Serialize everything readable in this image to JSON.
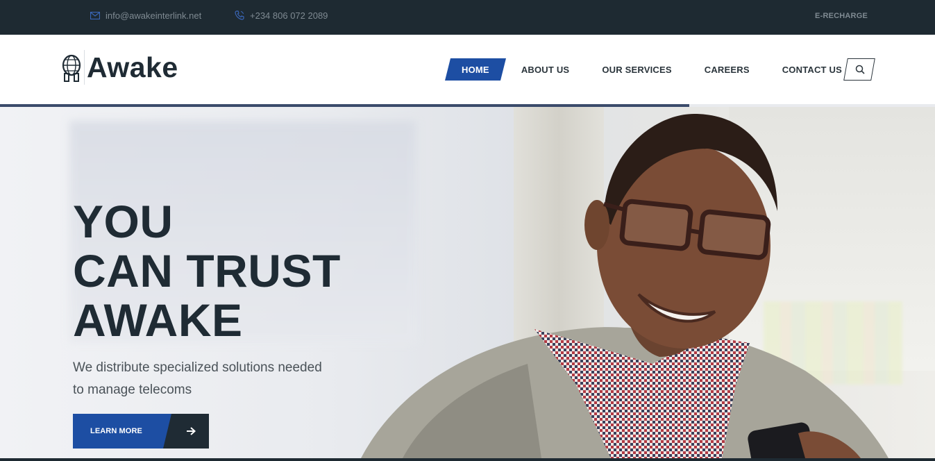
{
  "topbar": {
    "email": "info@awakeinterlink.net",
    "phone": "+234 806 072 2089",
    "erecharge_label": "E-RECHARGE",
    "icons": [
      "mail-icon",
      "phone-icon"
    ]
  },
  "header": {
    "brand": "Awake",
    "nav": [
      {
        "label": "HOME",
        "active": true
      },
      {
        "label": "ABOUT US",
        "active": false
      },
      {
        "label": "OUR SERVICES",
        "active": false
      },
      {
        "label": "CAREERS",
        "active": false
      },
      {
        "label": "CONTACT US",
        "active": false
      }
    ],
    "search_icon": "search-icon"
  },
  "slider": {
    "progress_fraction": 0.737
  },
  "hero": {
    "headline": [
      "YOU",
      "CAN TRUST",
      "AWAKE"
    ],
    "subtext_line1": "We distribute specialized solutions needed",
    "subtext_line2": "to manage telecoms",
    "cta_label": "LEARN MORE",
    "cta_icon": "arrow-right-icon"
  },
  "colors": {
    "accent": "#1d4ea3",
    "dark": "#1f2b34",
    "topbar_bg": "#1e2a32"
  }
}
